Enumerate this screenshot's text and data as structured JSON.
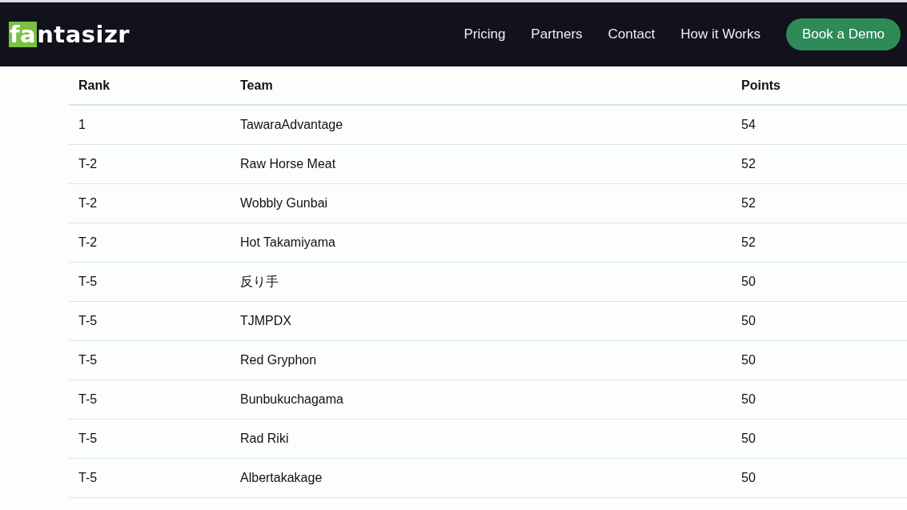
{
  "logo": {
    "highlighted": "fa",
    "rest": "ntasizr"
  },
  "nav": {
    "links": [
      "Pricing",
      "Partners",
      "Contact",
      "How it Works"
    ],
    "cta": "Book a Demo"
  },
  "table": {
    "columns": [
      "Rank",
      "Team",
      "Points"
    ],
    "rows": [
      [
        "1",
        "TawaraAdvantage",
        "54"
      ],
      [
        "T-2",
        "Raw Horse Meat",
        "52"
      ],
      [
        "T-2",
        "Wobbly Gunbai",
        "52"
      ],
      [
        "T-2",
        "Hot Takamiyama",
        "52"
      ],
      [
        "T-5",
        "反り手",
        "50"
      ],
      [
        "T-5",
        "TJMPDX",
        "50"
      ],
      [
        "T-5",
        "Red Gryphon",
        "50"
      ],
      [
        "T-5",
        "Bunbukuchagama",
        "50"
      ],
      [
        "T-5",
        "Rad Riki",
        "50"
      ],
      [
        "T-5",
        "Albertakakage",
        "50"
      ]
    ]
  }
}
